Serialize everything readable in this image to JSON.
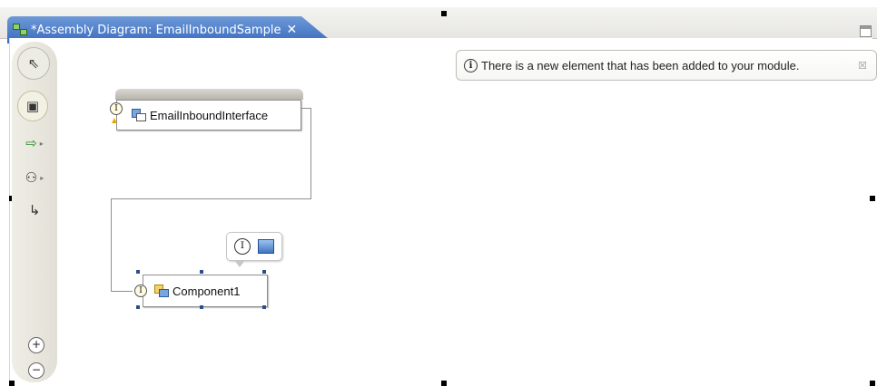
{
  "editor": {
    "tab_title": "*Assembly Diagram: EmailInboundSample",
    "tab_close": "✕",
    "maximize_icon": "maximize-icon"
  },
  "notification": {
    "icon": "ⓘ",
    "text": "There is a new element that has been added to your module.",
    "close": "☒"
  },
  "palette": {
    "items": [
      {
        "name": "selection-tool",
        "glyph": "⇖"
      },
      {
        "name": "components",
        "glyph": "▣"
      },
      {
        "name": "imports-exports",
        "glyph": "⇨"
      },
      {
        "name": "process-tools",
        "glyph": "⚇"
      },
      {
        "name": "wiring",
        "glyph": "↳"
      }
    ],
    "zoom_in": "+",
    "zoom_out": "−"
  },
  "diagram": {
    "export_label": "EmailInboundInterface",
    "component_label": "Component1",
    "interface_glyph": "I",
    "add_interface_glyph": "I"
  }
}
